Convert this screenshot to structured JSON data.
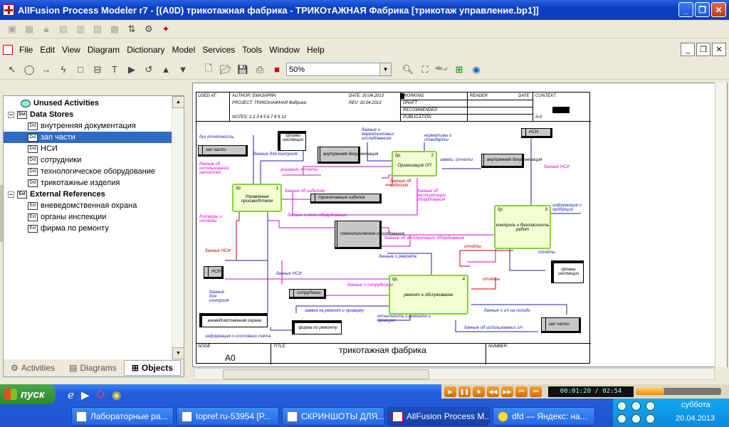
{
  "window": {
    "title": "AllFusion Process Modeler r7 - [(A0D) трикотажная фабрика - ТРИКОтАЖНАЯ Фабрика  [трикотаж управление.bp1]]"
  },
  "menu": [
    "File",
    "Edit",
    "View",
    "Diagram",
    "Dictionary",
    "Model",
    "Services",
    "Tools",
    "Window",
    "Help"
  ],
  "zoom": "50%",
  "tree": {
    "unused": "Unused Activities",
    "data_stores": "Data Stores",
    "ds_items": [
      "внутренняя документация",
      "зап части",
      "НСИ",
      "сотрудники",
      "технологическое оборудование",
      "трикотажные изделия"
    ],
    "external": "External References",
    "ext_items": [
      "вневедомственная охрана",
      "органы инспекции",
      "фирма по ремонту"
    ]
  },
  "tabs": {
    "activities": "Activities",
    "diagrams": "Diagrams",
    "objects": "Objects"
  },
  "form": {
    "used_at": "USED AT:",
    "author": "AUTHOR:  ЕМАЗАРЯН",
    "project": "PROJECT:  ТРИКОтАЖНАЯ Фабрика",
    "date": "DATE:  20.04.2013",
    "rev": "REV:  20.04.2013",
    "notes": "NOTES:  1  2  3  4  5  6  7  8  9  10",
    "working": "WORKING",
    "draft": "DRAFT",
    "recommended": "RECOMMENDED",
    "publication": "PUBLICATION",
    "reader": "READER",
    "date2": "DATE",
    "context": "CONTEXT:",
    "a0": "A-0",
    "node_label": "NODE:",
    "node_value": "A0",
    "title_label": "TITLE:",
    "title_value": "трикотажная фабрика",
    "number_label": "NUMBER:"
  },
  "activities": [
    {
      "label": "Управление производством",
      "no": "1",
      "br": "0р."
    },
    {
      "label": "Организация ОП",
      "no": "2",
      "br": "0р."
    },
    {
      "label": "контроль и безопасность работ",
      "no": "3",
      "br": "0р."
    },
    {
      "label": "ремонт и обслуживание",
      "no": "4",
      "br": "0р."
    }
  ],
  "data_stores": [
    "зап части",
    "внутренняя документация",
    "трикотажные изделия",
    "технологическое оборудование",
    "внутренняя документация",
    "НСИ",
    "сотрудники",
    "НСИ",
    "зап части"
  ],
  "externals": [
    "органы инспекции",
    "вневедомственная охрана",
    "фирма по ремонту",
    "органы инспекции"
  ],
  "arrow_labels": [
    "бух отчетность",
    "данные для контроля",
    "данные об использовании запчастей",
    "указания, отчеты",
    "данные об изделиях",
    "данные о маркетинговых исследованиях",
    "нормативы и стандарты",
    "заявки, отчеты",
    "данные об изделиях",
    "данные об эксплуатации оборудования",
    "данные НСИ",
    "информация о продукции",
    "договоры и отчеты",
    "данные о техн оборудовании",
    "данные об эксплуатации оборудования",
    "данные НСИ",
    "данные о ремонте",
    "отчёты",
    "отчёты",
    "отчёты",
    "данные НСИ",
    "данные для контроля",
    "данные о сотрудниках",
    "заявка на ремонт и проверку",
    "отчетность о ремонте и проверке",
    "данные о з/ч на складе",
    "данные об использовании з/ч",
    "информация о состоянии счета"
  ],
  "taskbar": {
    "start": "пуск",
    "tasks": [
      "Лабораторные ра...",
      "topref.ru-53954 [Р...",
      "СКРИНШОТЫ ДЛЯ...",
      "AllFusion Process M...",
      "dfd — Яндекс: на..."
    ],
    "media_time": "00:01:20 / 02:54",
    "media_progress": 0.33,
    "day": "суббота",
    "date": "20.04.2013"
  }
}
